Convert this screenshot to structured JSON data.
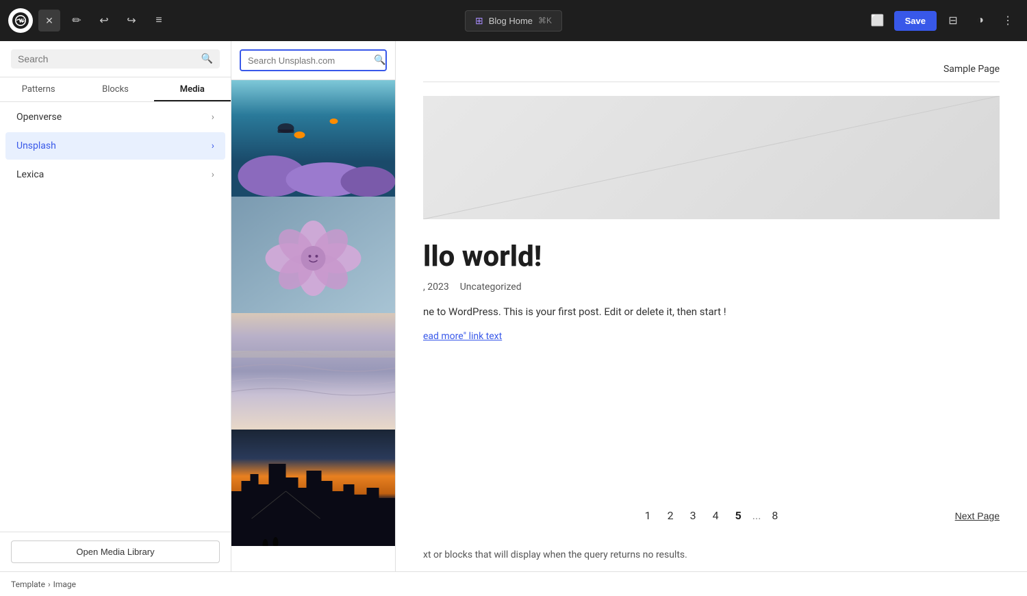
{
  "toolbar": {
    "close_label": "✕",
    "pencil_icon": "✏",
    "undo_icon": "↩",
    "redo_icon": "↪",
    "list_icon": "≡",
    "blog_home_label": "Blog Home",
    "shortcut": "⌘K",
    "save_label": "Save",
    "view_icon": "⬜",
    "layout_icon": "⊟",
    "contrast_icon": "◑",
    "more_icon": "⋮"
  },
  "sidebar": {
    "search_placeholder": "Search",
    "tabs": [
      {
        "label": "Patterns"
      },
      {
        "label": "Blocks"
      },
      {
        "label": "Media"
      }
    ],
    "active_tab": "Media",
    "nav_items": [
      {
        "label": "Openverse",
        "has_arrow": true,
        "active": false
      },
      {
        "label": "Unsplash",
        "has_arrow": true,
        "active": true
      },
      {
        "label": "Lexica",
        "has_arrow": true,
        "active": false
      }
    ],
    "open_media_label": "Open Media Library"
  },
  "media_panel": {
    "search_placeholder": "Search Unsplash.com",
    "images": [
      {
        "alt": "Underwater coral reef with diver",
        "type": "underwater"
      },
      {
        "alt": "Purple inflatable flower",
        "type": "flower"
      },
      {
        "alt": "Ocean waves long exposure",
        "type": "ocean"
      },
      {
        "alt": "City skyline at sunset",
        "type": "city"
      }
    ]
  },
  "editor": {
    "nav_link": "Sample Page",
    "post_title": "llo world!",
    "post_date": ", 2023",
    "post_category": "Uncategorized",
    "post_excerpt": "ne to WordPress. This is your first post. Edit or delete it, then start\n!",
    "read_more": "ead more\" link text",
    "pagination": {
      "pages": [
        "1",
        "2",
        "3",
        "4",
        "5",
        "...",
        "8"
      ],
      "current": "5",
      "next_label": "Next Page"
    },
    "no_results_text": "xt or blocks that will display when the query returns no results."
  },
  "breadcrumb": {
    "items": [
      "Template",
      "Image"
    ]
  }
}
